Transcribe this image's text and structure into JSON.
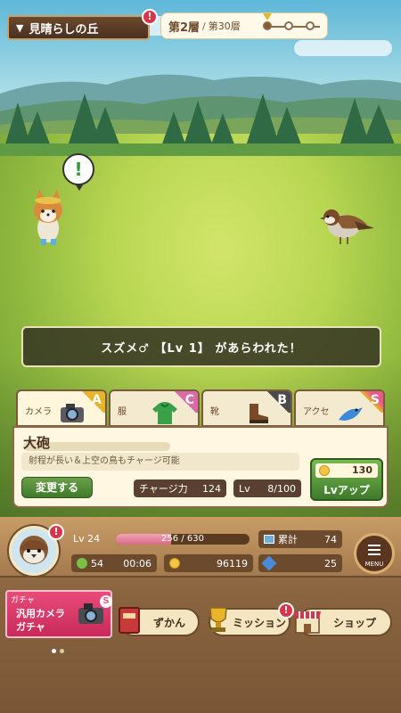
{
  "location": {
    "name": "見晴らしの丘",
    "alert": "!"
  },
  "floor": {
    "current": "第2層",
    "separator": "/",
    "total": "第30層"
  },
  "encounter": {
    "bubble": "!",
    "message": "スズメ♂ 【Lv 1】 があらわれた！"
  },
  "tabs": [
    {
      "label": "カメラ",
      "grade": "A",
      "grade_color": "#e8b52a",
      "icon": "camera-icon"
    },
    {
      "label": "服",
      "grade": "C",
      "grade_color": "#d86aa8",
      "icon": "hoodie-icon"
    },
    {
      "label": "靴",
      "grade": "B",
      "grade_color": "#4a4a4a",
      "icon": "boots-icon"
    },
    {
      "label": "アクセ",
      "grade": "S",
      "grade_color": "#e85a8a",
      "icon": "bird-accessory-icon"
    }
  ],
  "weapon": {
    "name": "大砲",
    "description": "射程が長い＆上空の鳥もチャージ可能",
    "change_label": "変更する",
    "charge_label": "チャージ力",
    "charge_value": "124",
    "level_label": "Lv",
    "level_value": "8/100",
    "levelup_cost": "130",
    "levelup_label": "Lvアップ"
  },
  "player": {
    "level": "Lv 24",
    "exp_text": "256 / 630",
    "exp_fraction": 0.41,
    "total_label": "累計",
    "total_value": "74",
    "stamina": "54",
    "timer": "00:06",
    "coins": "96119",
    "gems": "25",
    "avatar_alert": "!"
  },
  "menu": {
    "label": "MENU"
  },
  "gacha": {
    "tag": "ガチャ",
    "line1": "汎用カメラ",
    "line2": "ガチャ"
  },
  "nav": [
    {
      "label": "ずかん",
      "icon": "book-icon"
    },
    {
      "label": "ミッション",
      "icon": "trophy-icon",
      "alert": "!"
    },
    {
      "label": "ショップ",
      "icon": "shop-icon"
    }
  ]
}
